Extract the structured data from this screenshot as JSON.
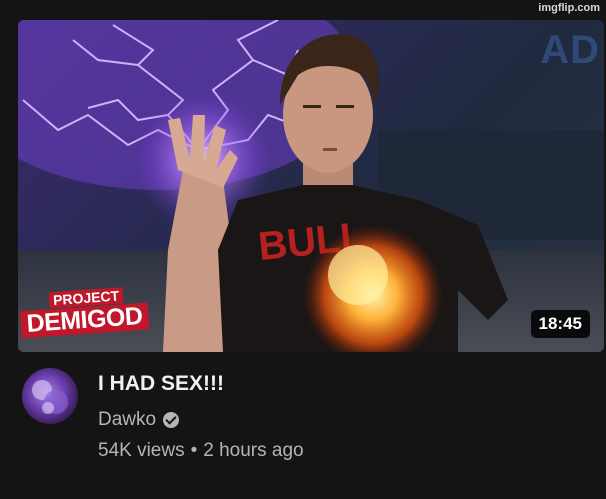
{
  "watermark": "imgflip.com",
  "video": {
    "title": "I HAD SEX!!!",
    "duration": "18:45",
    "channel": "Dawko",
    "views": "54K views",
    "age": "2 hours ago",
    "separator": "•",
    "thumbnail_logo_line1": "PROJECT",
    "thumbnail_logo_line2": "DEMIGOD",
    "thumbnail_corner_text": "AD",
    "shirt_text": "BULL"
  },
  "colors": {
    "background": "#141414",
    "lightning": "#b77bff",
    "fire": "#ff8a1a",
    "logo_red": "#c0182a"
  },
  "icons": {
    "verified": "verified-badge-icon"
  }
}
